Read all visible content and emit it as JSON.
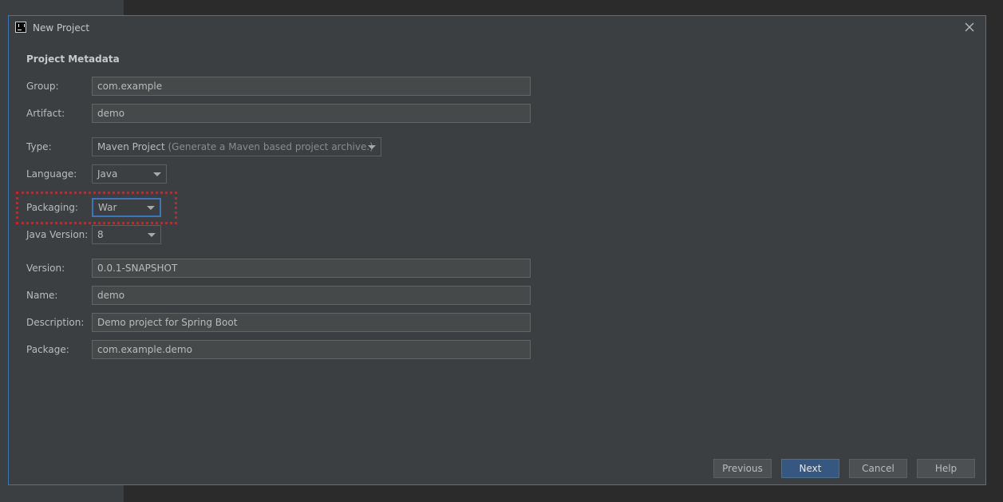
{
  "window": {
    "title": "New Project"
  },
  "section": {
    "title": "Project Metadata"
  },
  "fields": {
    "group": {
      "label": "Group:",
      "value": "com.example"
    },
    "artifact": {
      "label": "Artifact:",
      "value": "demo"
    },
    "type": {
      "label": "Type:",
      "value": "Maven Project",
      "hint": "(Generate a Maven based project archive.)"
    },
    "language": {
      "label": "Language:",
      "value": "Java"
    },
    "packaging": {
      "label": "Packaging:",
      "value": "War"
    },
    "java_version": {
      "label": "Java Version:",
      "value": "8"
    },
    "version": {
      "label": "Version:",
      "value": "0.0.1-SNAPSHOT"
    },
    "name": {
      "label": "Name:",
      "value": "demo"
    },
    "description": {
      "label": "Description:",
      "value": "Demo project for Spring Boot"
    },
    "package": {
      "label": "Package:",
      "value": "com.example.demo"
    }
  },
  "buttons": {
    "previous": "Previous",
    "next": "Next",
    "cancel": "Cancel",
    "help": "Help"
  },
  "colors": {
    "accent": "#3d75b8",
    "highlight": "#d0202a",
    "dialog_bg": "#3c3f41"
  }
}
